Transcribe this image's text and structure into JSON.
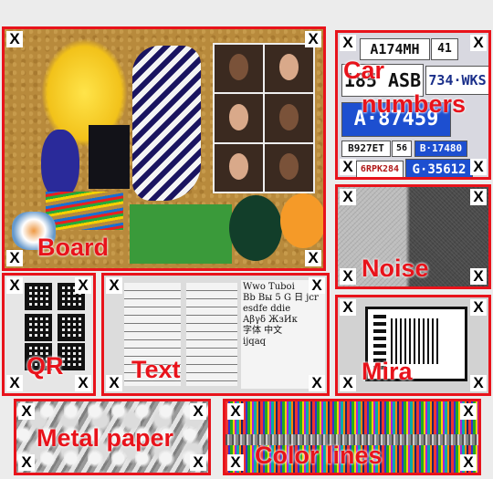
{
  "panels": {
    "board": {
      "label": "Board"
    },
    "car": {
      "label_line1": "Car",
      "label_line2": "numbers"
    },
    "noise": {
      "label": "Noise"
    },
    "qr": {
      "label": "QR"
    },
    "text": {
      "label": "Text"
    },
    "mira": {
      "label": "Mira"
    },
    "metal": {
      "label": "Metal paper"
    },
    "lines": {
      "label": "Color lines"
    }
  },
  "marker": "X",
  "plates": [
    {
      "text": "A174MH",
      "extra": "41"
    },
    {
      "text": "185 ASB"
    },
    {
      "text": "734·WKS"
    },
    {
      "text": "A·87459"
    },
    {
      "text": "B927ET",
      "extra": "56"
    },
    {
      "text": "B·17480"
    },
    {
      "text": "6RPK284"
    },
    {
      "text": "G·35612"
    }
  ],
  "font_sample": "Wwo Tuboi\nBb Вы 5 G 日 jcr\nesdfe ddie\nΑβγδ ЖзИк\n字体 中文\nijqaq",
  "colors": {
    "accent": "#e8131b"
  }
}
